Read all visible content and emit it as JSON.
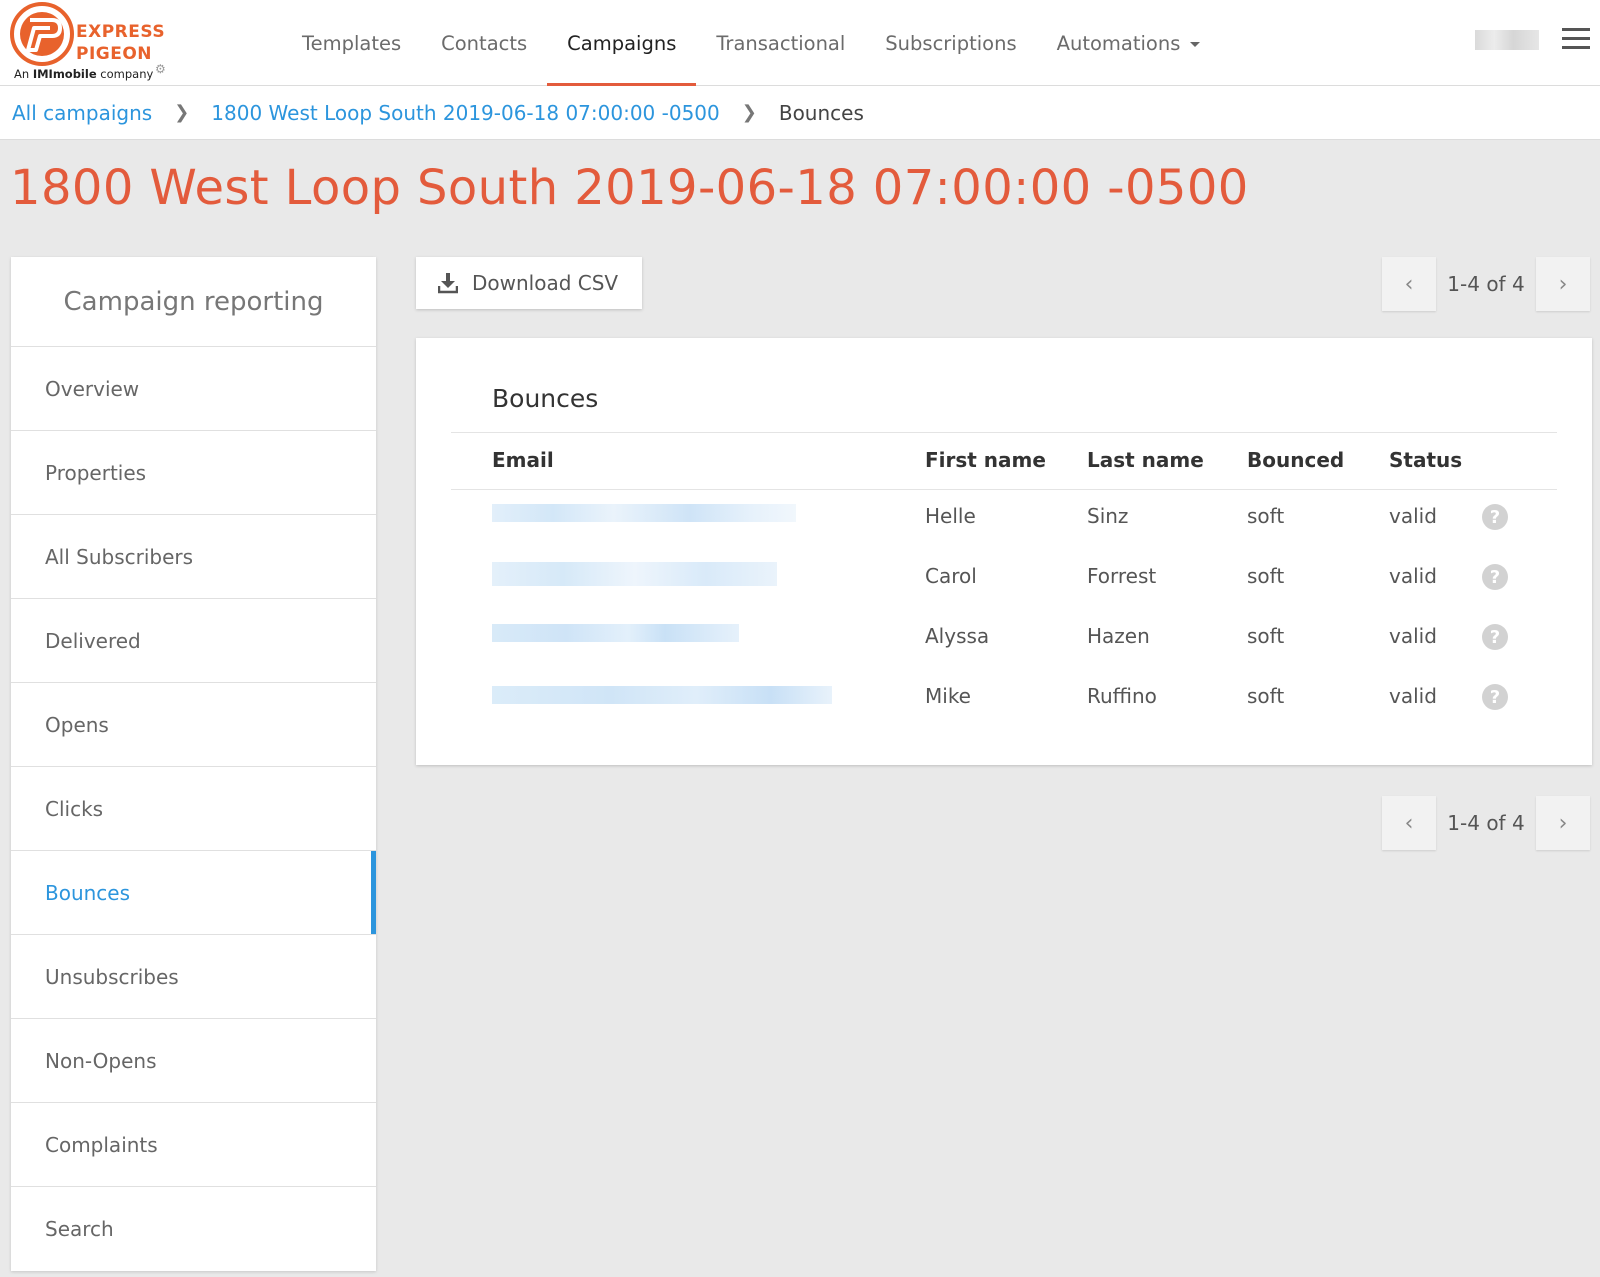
{
  "brand": {
    "logo_line1": "EXPRESS",
    "logo_line2": "PIGEON",
    "tagline_prefix": "An ",
    "tagline_bold": "IMImobile",
    "tagline_suffix": " company",
    "color": "#e8622c"
  },
  "nav": {
    "items": [
      {
        "label": "Templates"
      },
      {
        "label": "Contacts"
      },
      {
        "label": "Campaigns"
      },
      {
        "label": "Transactional"
      },
      {
        "label": "Subscriptions"
      },
      {
        "label": "Automations"
      }
    ],
    "active": "Campaigns"
  },
  "breadcrumb": {
    "root": "All campaigns",
    "campaign": "1800 West Loop South 2019-06-18 07:00:00 -0500",
    "current": "Bounces"
  },
  "page": {
    "title": "1800 West Loop South 2019-06-18 07:00:00 -0500"
  },
  "sidebar": {
    "heading": "Campaign reporting",
    "items": [
      {
        "label": "Overview"
      },
      {
        "label": "Properties"
      },
      {
        "label": "All Subscribers"
      },
      {
        "label": "Delivered"
      },
      {
        "label": "Opens"
      },
      {
        "label": "Clicks"
      },
      {
        "label": "Bounces"
      },
      {
        "label": "Unsubscribes"
      },
      {
        "label": "Non-Opens"
      },
      {
        "label": "Complaints"
      },
      {
        "label": "Search"
      }
    ],
    "active": "Bounces"
  },
  "toolbar": {
    "download_label": "Download CSV"
  },
  "pagination": {
    "label": "1-4 of 4"
  },
  "table": {
    "title": "Bounces",
    "columns": [
      "Email",
      "First name",
      "Last name",
      "Bounced",
      "Status"
    ],
    "rows": [
      {
        "first_name": "Helle",
        "last_name": "Sinz",
        "bounced": "soft",
        "status": "valid"
      },
      {
        "first_name": "Carol",
        "last_name": "Forrest",
        "bounced": "soft",
        "status": "valid"
      },
      {
        "first_name": "Alyssa",
        "last_name": "Hazen",
        "bounced": "soft",
        "status": "valid"
      },
      {
        "first_name": "Mike",
        "last_name": "Ruffino",
        "bounced": "soft",
        "status": "valid"
      }
    ]
  },
  "colors": {
    "accent": "#e35b3c",
    "link": "#2c95dd"
  }
}
